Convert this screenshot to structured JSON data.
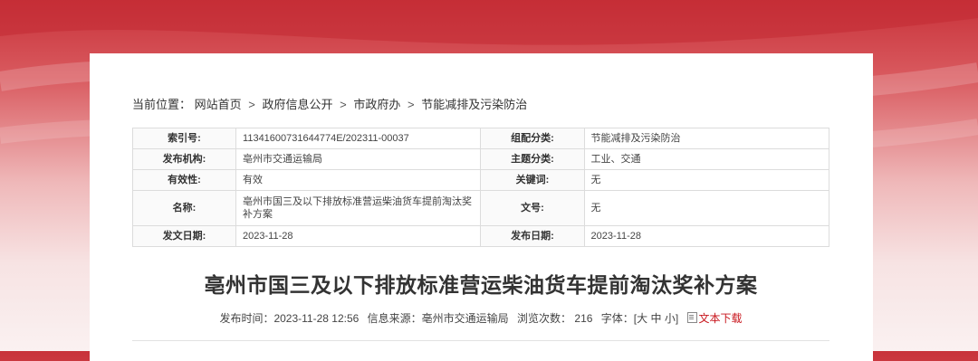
{
  "breadcrumb": {
    "label": "当前位置：",
    "items": [
      "网站首页",
      "政府信息公开",
      "市政府办",
      "节能减排及污染防治"
    ],
    "separator": ">"
  },
  "meta": {
    "index_no_label": "索引号:",
    "index_no": "11341600731644774E/202311-00037",
    "category_label": "组配分类:",
    "category": "节能减排及污染防治",
    "publisher_label": "发布机构:",
    "publisher": "亳州市交通运输局",
    "topic_label": "主题分类:",
    "topic": "工业、交通",
    "validity_label": "有效性:",
    "validity": "有效",
    "keywords_label": "关键词:",
    "keywords": "无",
    "name_label": "名称:",
    "name": "亳州市国三及以下排放标准营运柴油货车提前淘汰奖补方案",
    "doc_no_label": "文号:",
    "doc_no": "无",
    "issue_date_label": "发文日期:",
    "issue_date": "2023-11-28",
    "publish_date_label": "发布日期:",
    "publish_date": "2023-11-28"
  },
  "article": {
    "title": "亳州市国三及以下排放标准营运柴油货车提前淘汰奖补方案",
    "publish_time_label": "发布时间：",
    "publish_time": "2023-11-28 12:56",
    "source_label": "信息来源：",
    "source": "亳州市交通运输局",
    "views_label": "浏览次数：",
    "views": "216",
    "font_label": "字体：[",
    "font_large": "大",
    "font_medium": "中",
    "font_small": "小",
    "font_close": "]",
    "download_label": "文本下载"
  },
  "colors": {
    "header_red": "#c8323a",
    "download_red": "#c8161d"
  }
}
